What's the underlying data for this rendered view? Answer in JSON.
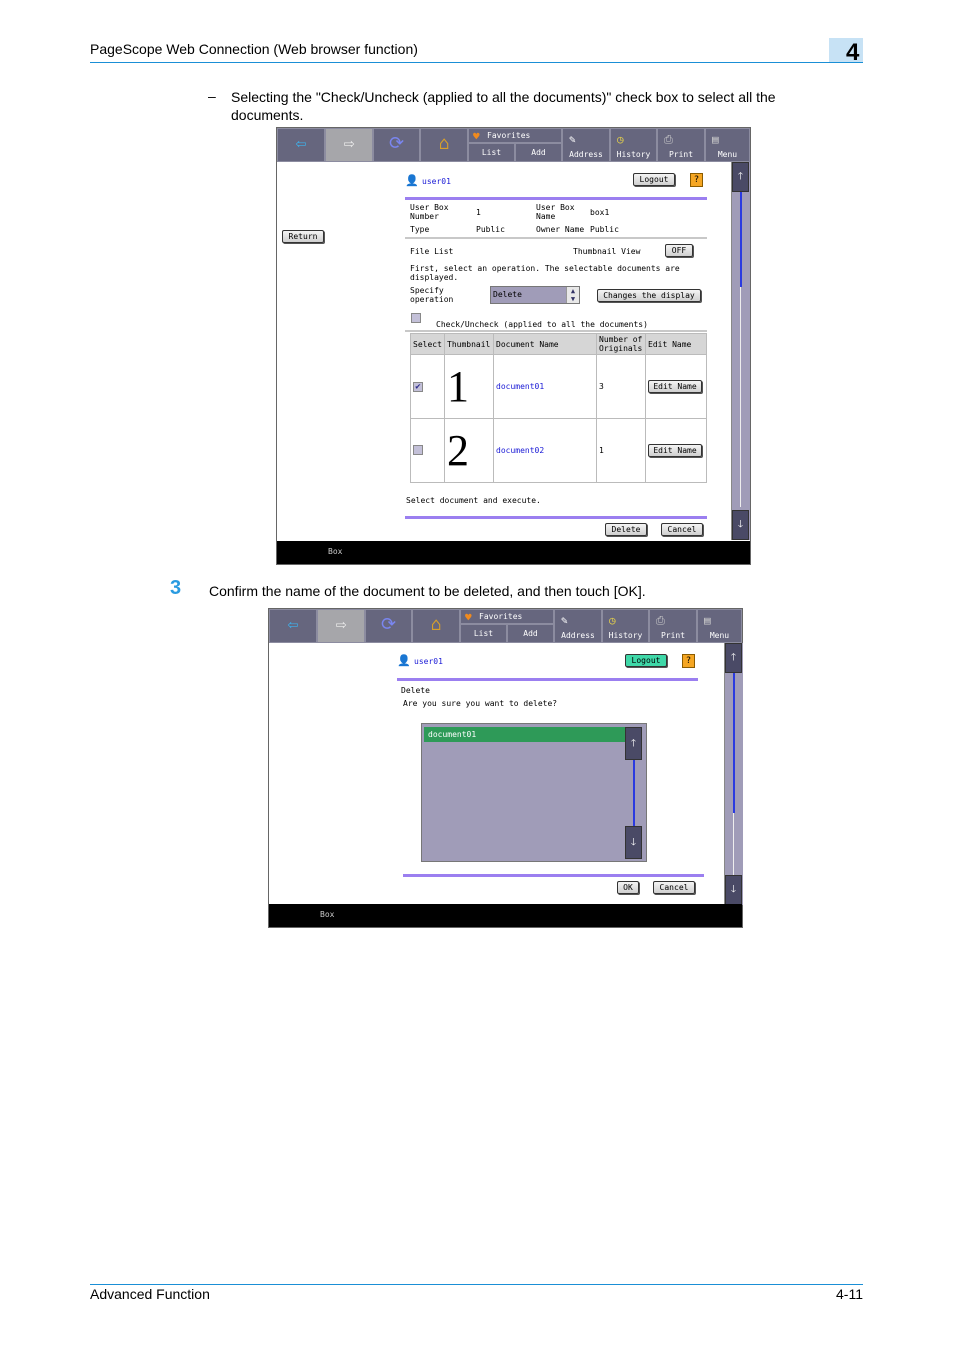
{
  "page": {
    "header_title": "PageScope Web Connection (Web browser function)",
    "chapter": "4",
    "bullet_dash": "–",
    "bullet_text": "Selecting the \"Check/Uncheck (applied to all the documents)\" check box to select all the documents.",
    "step_number": "3",
    "step_text": "Confirm the name of the document to be deleted, and then touch [OK].",
    "footer_left": "Advanced Function",
    "footer_right": "4-11",
    "accent_color": "#1a8fd6"
  },
  "toolbar": {
    "back_icon": "arrow-left-icon",
    "forward_icon": "arrow-right-icon",
    "refresh_icon": "refresh-icon",
    "home_icon": "home-icon",
    "favorites_label": "Favorites",
    "list_label": "List",
    "add_label": "Add",
    "address_label": "Address",
    "history_label": "History",
    "print_label": "Print",
    "menu_label": "Menu"
  },
  "screen1": {
    "user": "user01",
    "logout_label": "Logout",
    "help_label": "?",
    "return_label": "Return",
    "info": {
      "box_number_label": "User Box Number",
      "box_number_value": "1",
      "box_name_label": "User Box Name",
      "box_name_value": "box1",
      "type_label": "Type",
      "type_value": "Public",
      "owner_label": "Owner Name",
      "owner_value": "Public"
    },
    "file_list_label": "File List",
    "thumbnail_view_label": "Thumbnail View",
    "thumbnail_toggle": "OFF",
    "instruction": "First, select an operation. The selectable documents are displayed.",
    "specify_operation_label": "Specify operation",
    "operation_value": "Delete",
    "changes_display_label": "Changes the display",
    "check_all_label": "Check/Uncheck (applied to all the documents)",
    "table": {
      "headers": [
        "Select",
        "Thumbnail",
        "Document Name",
        "Number of Originals",
        "Edit Name"
      ],
      "rows": [
        {
          "checked": true,
          "thumbnail": "1",
          "name": "document01",
          "originals": "3",
          "edit": "Edit Name"
        },
        {
          "checked": false,
          "thumbnail": "2",
          "name": "document02",
          "originals": "1",
          "edit": "Edit Name"
        }
      ]
    },
    "footer_instruction": "Select document and execute.",
    "delete_label": "Delete",
    "cancel_label": "Cancel",
    "status_bar": "Box"
  },
  "screen2": {
    "user": "user01",
    "logout_label": "Logout",
    "help_label": "?",
    "title": "Delete",
    "question": "Are you sure you want to delete?",
    "list_items": [
      "document01"
    ],
    "ok_label": "OK",
    "cancel_label": "Cancel",
    "status_bar": "Box"
  }
}
